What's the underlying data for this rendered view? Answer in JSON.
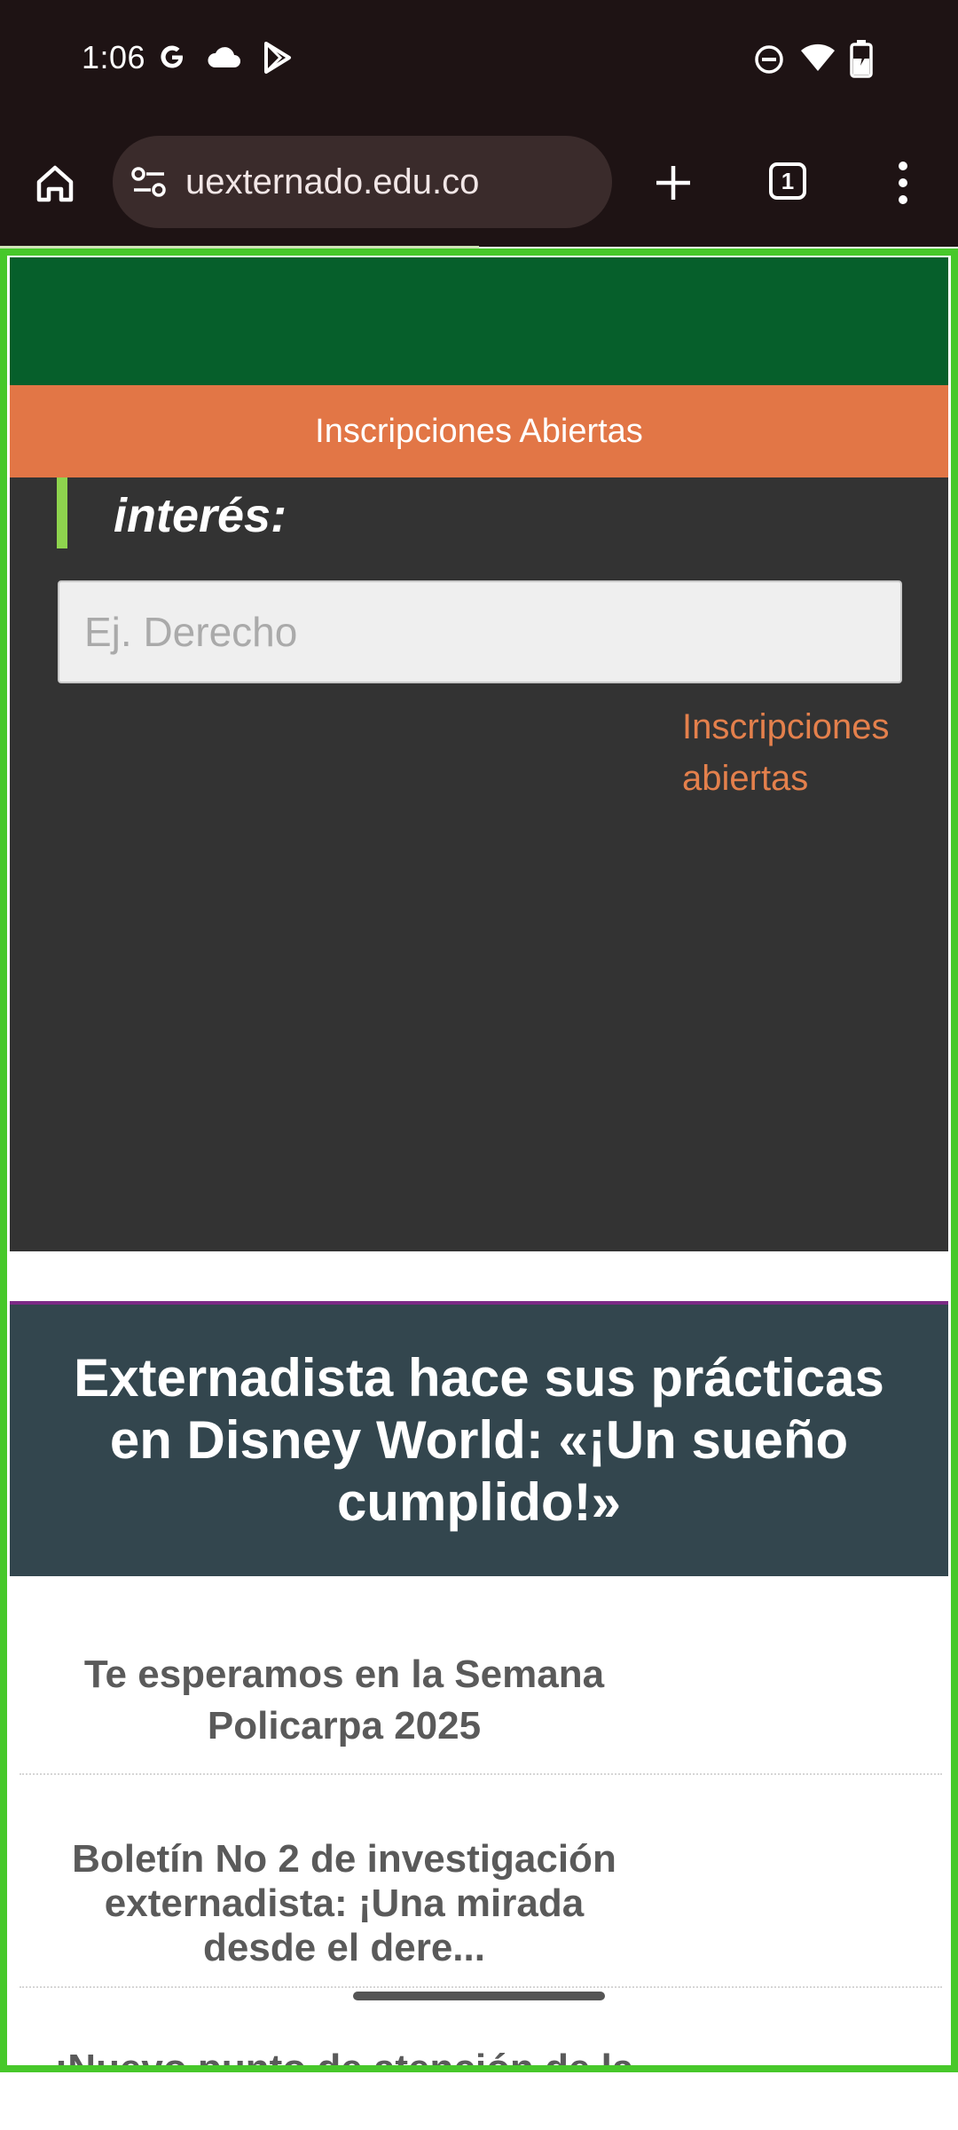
{
  "status_bar": {
    "time": "1:06",
    "left_icons": [
      "google-icon",
      "cloud-icon",
      "play-store-icon"
    ],
    "right_icons": [
      "dnd-icon",
      "wifi-icon",
      "battery-icon"
    ]
  },
  "browser": {
    "url": "uexternado.edu.co",
    "tab_count": "1"
  },
  "page": {
    "banner_text": "Inscripciones Abiertas",
    "search_heading_tail": "interés:",
    "search_placeholder": "Ej. Derecho",
    "inscripciones_link": "Inscripciones abiertas",
    "feature_title": "Externadista hace sus prácticas en Disney World: «¡Un sueño cumplido!»",
    "news": [
      {
        "title": "Te esperamos en la Semana Policarpa 2025"
      },
      {
        "title": "Boletín No 2 de investigación externadista: ¡Una mirada desde el dere..."
      },
      {
        "title": "¡Nuevo punto de atención de la"
      }
    ]
  },
  "colors": {
    "green_band": "#065f2b",
    "orange_band": "#e27646",
    "dark_section": "#333333",
    "feature_bg": "#33464e",
    "link_orange": "#e4804c",
    "frame_highlight": "#47c82a"
  }
}
